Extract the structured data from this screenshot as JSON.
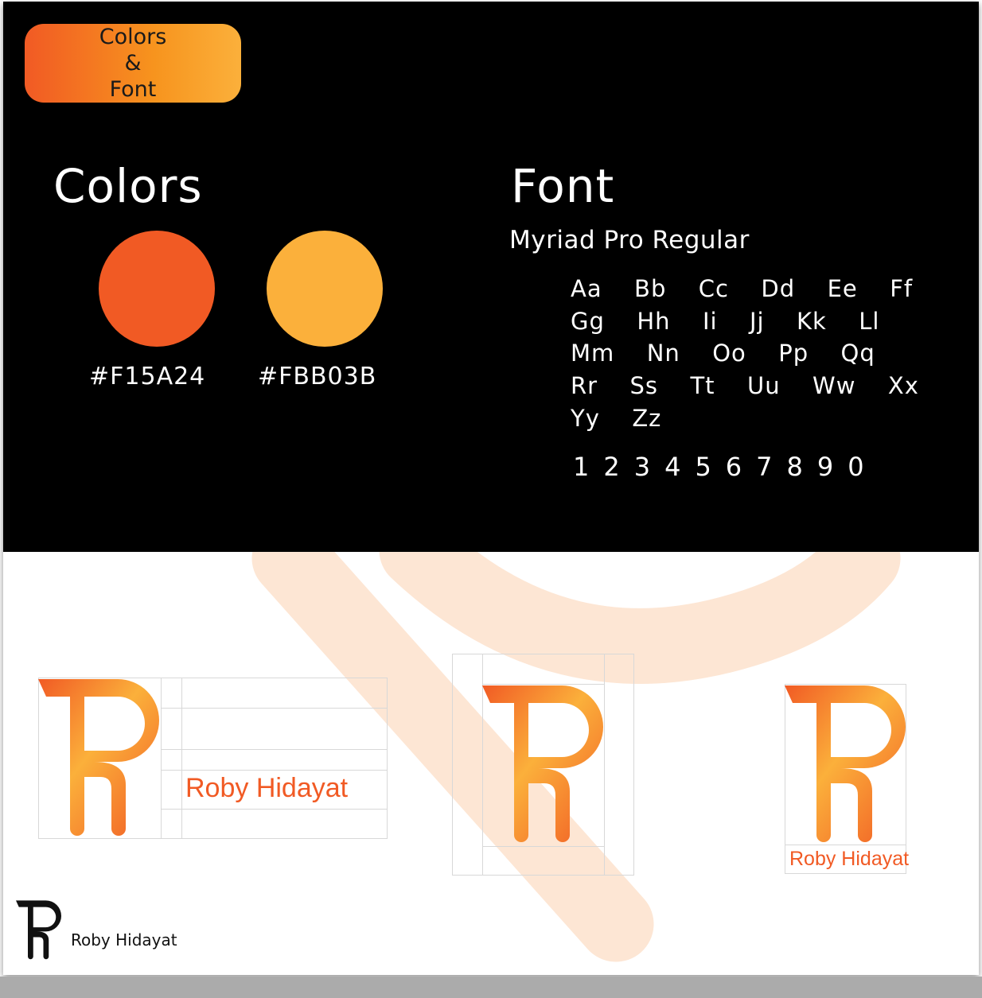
{
  "badge": {
    "line1": "Colors",
    "line2": "&",
    "line3": "Font"
  },
  "colors": {
    "title": "Colors",
    "swatches": [
      {
        "hex": "#F15A24",
        "label": "#F15A24"
      },
      {
        "hex": "#FBB03B",
        "label": "#FBB03B"
      }
    ]
  },
  "font": {
    "title": "Font",
    "name": "Myriad Pro Regular",
    "alphabet_rows": [
      "Aa  Bb  Cc  Dd  Ee  Ff",
      "Gg  Hh  Ii  Jj  Kk  Ll",
      "Mm  Nn  Oo  Pp  Qq",
      "Rr  Ss  Tt  Uu  Ww  Xx",
      "Yy  Zz"
    ],
    "digits": "1234567890"
  },
  "logos": {
    "horizontal_text": "Roby Hidayat",
    "stacked_text": "Roby Hidayat",
    "mono_text": "Roby Hidayat"
  },
  "palette": {
    "primary": "#F15A24",
    "secondary": "#FBB03B",
    "background": "#000000"
  }
}
